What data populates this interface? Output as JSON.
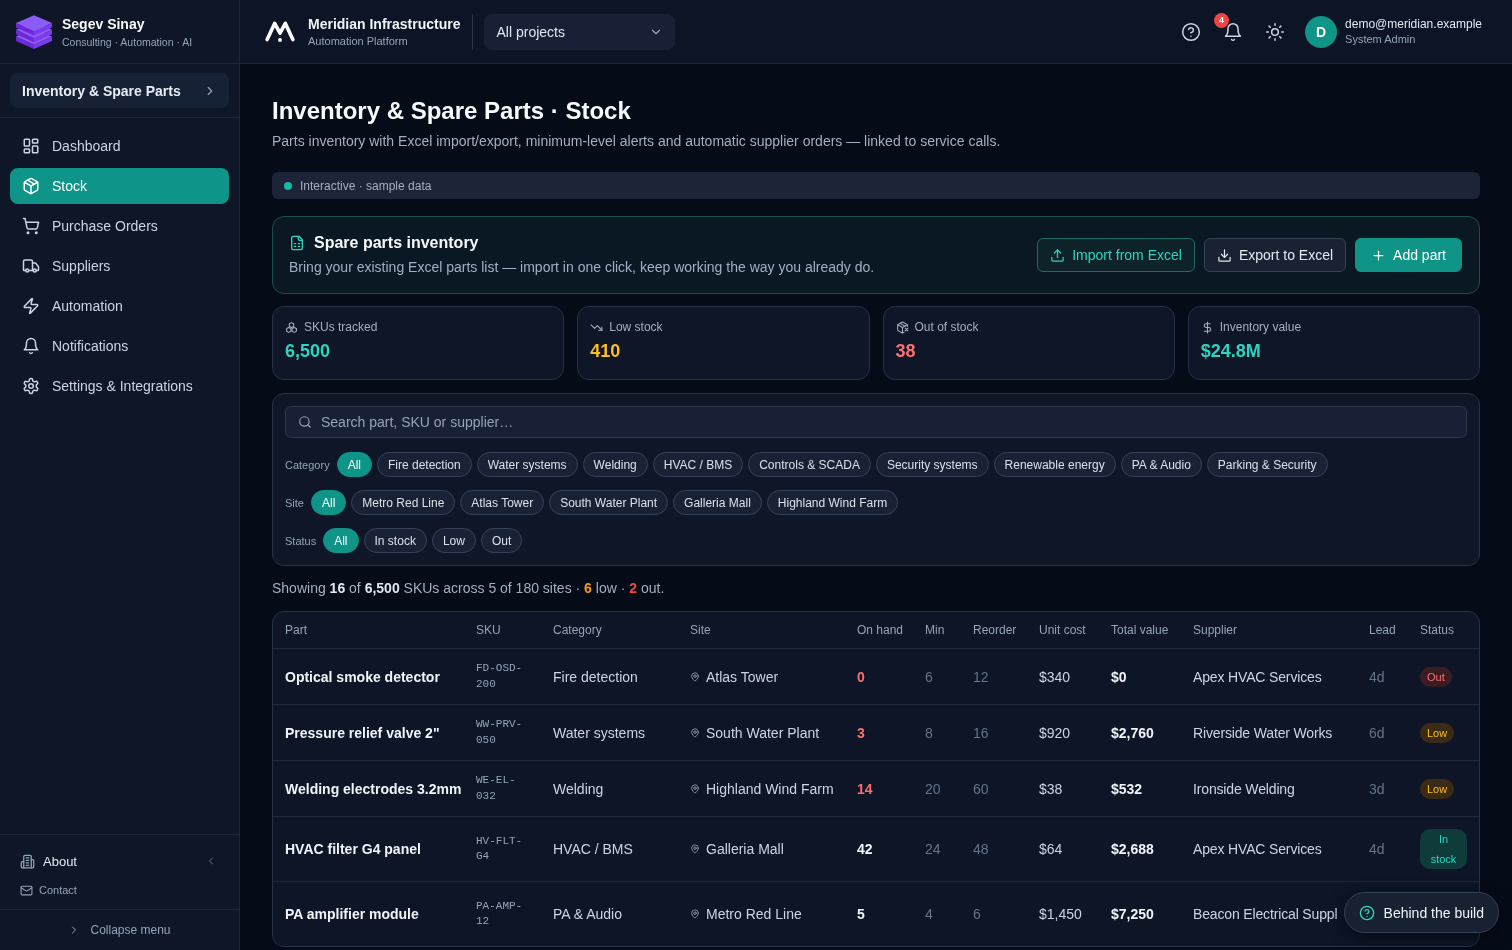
{
  "sidebar": {
    "brand": {
      "name": "Segev Sinay",
      "tagline": "Consulting · Automation · AI"
    },
    "module": "Inventory & Spare Parts",
    "nav": [
      {
        "label": "Dashboard",
        "selected": false
      },
      {
        "label": "Stock",
        "selected": true
      },
      {
        "label": "Purchase Orders",
        "selected": false
      },
      {
        "label": "Suppliers",
        "selected": false
      },
      {
        "label": "Automation",
        "selected": false
      },
      {
        "label": "Notifications",
        "selected": false
      },
      {
        "label": "Settings & Integrations",
        "selected": false
      }
    ],
    "footer_links": [
      {
        "label": "About"
      },
      {
        "label": "Contact"
      }
    ],
    "collapse": "Collapse menu"
  },
  "topbar": {
    "app_name": "Meridian Infrastructure",
    "app_subtitle": "Automation Platform",
    "project_select": {
      "value": "All projects"
    },
    "notifications_count": "4",
    "user": {
      "initial": "D",
      "email": "demo@meridian.example",
      "role": "System Admin"
    }
  },
  "page": {
    "title": "Inventory & Spare Parts · Stock",
    "subtitle": "Parts inventory with Excel import/export, minimum-level alerts and automatic supplier orders — linked to service calls.",
    "notice": "Interactive · sample data"
  },
  "import_panel": {
    "title": "Spare parts inventory",
    "description": "Bring your existing Excel parts list — import in one click, keep working the way you already do.",
    "actions": [
      {
        "label": "Import from Excel",
        "kind": "outline_accent"
      },
      {
        "label": "Export to Excel",
        "kind": "outline"
      },
      {
        "label": "Add part",
        "kind": "primary"
      }
    ]
  },
  "stats": [
    {
      "label": "SKUs tracked",
      "value": "6,500",
      "color": "#2dd4bf"
    },
    {
      "label": "Low stock",
      "value": "410",
      "color": "#fbbf24"
    },
    {
      "label": "Out of stock",
      "value": "38",
      "color": "#f87171"
    },
    {
      "label": "Inventory value",
      "value": "$24.8M",
      "color": "#2dd4bf"
    }
  ],
  "filters": {
    "search": {
      "placeholder": "Search part, SKU or supplier…"
    },
    "groups": [
      {
        "label": "Category",
        "options": [
          {
            "label": "All",
            "selected": true
          },
          {
            "label": "Fire detection",
            "selected": false
          },
          {
            "label": "Water systems",
            "selected": false
          },
          {
            "label": "Welding",
            "selected": false
          },
          {
            "label": "HVAC / BMS",
            "selected": false
          },
          {
            "label": "Controls & SCADA",
            "selected": false
          },
          {
            "label": "Security systems",
            "selected": false
          },
          {
            "label": "Renewable energy",
            "selected": false
          },
          {
            "label": "PA & Audio",
            "selected": false
          },
          {
            "label": "Parking & Security",
            "selected": false
          }
        ]
      },
      {
        "label": "Site",
        "options": [
          {
            "label": "All",
            "selected": true
          },
          {
            "label": "Metro Red Line",
            "selected": false
          },
          {
            "label": "Atlas Tower",
            "selected": false
          },
          {
            "label": "South Water Plant",
            "selected": false
          },
          {
            "label": "Galleria Mall",
            "selected": false
          },
          {
            "label": "Highland Wind Farm",
            "selected": false
          }
        ]
      },
      {
        "label": "Status",
        "options": [
          {
            "label": "All",
            "selected": true
          },
          {
            "label": "In stock",
            "selected": false
          },
          {
            "label": "Low",
            "selected": false
          },
          {
            "label": "Out",
            "selected": false
          }
        ]
      }
    ]
  },
  "summary": [
    {
      "text": "Showing **16** of **6,500** SKUs across 5 of 180 sites · ",
      "kind": "plain"
    },
    {
      "text": "6",
      "kind": "low"
    },
    {
      "text": " low · ",
      "kind": "plain"
    },
    {
      "text": "2",
      "kind": "out"
    },
    {
      "text": " out.",
      "kind": "plain"
    }
  ],
  "table": {
    "columns": [
      "Part",
      "SKU",
      "Category",
      "Site",
      "On hand",
      "Min",
      "Reorder",
      "Unit cost",
      "Total value",
      "Supplier",
      "Lead",
      "Status"
    ],
    "rows": [
      {
        "part": "Optical smoke detector",
        "sku": "FD-OSD-200",
        "category": "Fire detection",
        "site": "Atlas Tower",
        "on_hand": "0",
        "below_min": true,
        "min": "6",
        "reorder": "12",
        "unit_cost": "$340",
        "total_value": "$0",
        "supplier": "Apex HVAC Services",
        "lead": "4d",
        "status": {
          "label": "Out",
          "kind": "out"
        }
      },
      {
        "part": "Pressure relief valve 2\"",
        "sku": "WW-PRV-050",
        "category": "Water systems",
        "site": "South Water Plant",
        "on_hand": "3",
        "below_min": true,
        "min": "8",
        "reorder": "16",
        "unit_cost": "$920",
        "total_value": "$2,760",
        "supplier": "Riverside Water Works",
        "lead": "6d",
        "status": {
          "label": "Low",
          "kind": "low"
        }
      },
      {
        "part": "Welding electrodes 3.2mm",
        "sku": "WE-EL-032",
        "category": "Welding",
        "site": "Highland Wind Farm",
        "on_hand": "14",
        "below_min": true,
        "min": "20",
        "reorder": "60",
        "unit_cost": "$38",
        "total_value": "$532",
        "supplier": "Ironside Welding",
        "lead": "3d",
        "status": {
          "label": "Low",
          "kind": "low"
        }
      },
      {
        "part": "HVAC filter G4 panel",
        "sku": "HV-FLT-G4",
        "category": "HVAC / BMS",
        "site": "Galleria Mall",
        "on_hand": "42",
        "below_min": false,
        "min": "24",
        "reorder": "48",
        "unit_cost": "$64",
        "total_value": "$2,688",
        "supplier": "Apex HVAC Services",
        "lead": "4d",
        "status": {
          "label": "In stock",
          "kind": "in_stock"
        }
      },
      {
        "part": "PA amplifier module",
        "sku": "PA-AMP-12",
        "category": "PA & Audio",
        "site": "Metro Red Line",
        "on_hand": "5",
        "below_min": false,
        "min": "4",
        "reorder": "6",
        "unit_cost": "$1,450",
        "total_value": "$7,250",
        "supplier": "Beacon Electrical Suppl"
      }
    ]
  },
  "help_button": {
    "label": "Behind the build"
  }
}
